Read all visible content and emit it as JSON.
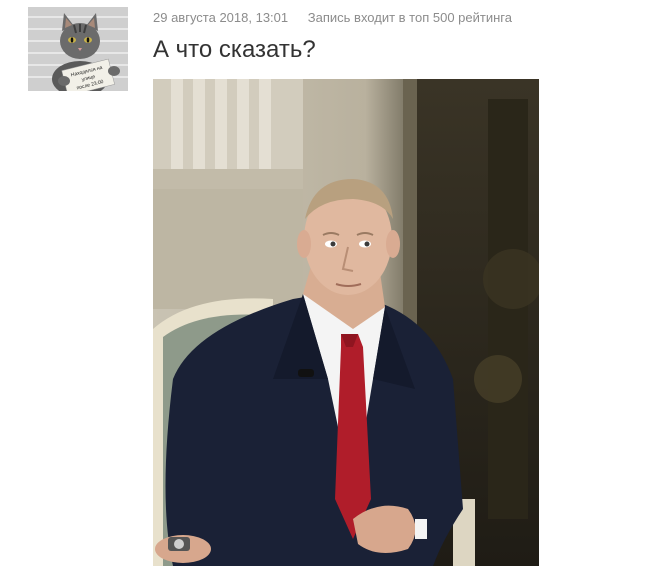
{
  "post": {
    "date": "29 августа 2018, 13:01",
    "rating_note": "Запись входит в топ 500 рейтинга",
    "title": "А что сказать?"
  },
  "avatar": {
    "sign_text": "Находился на улице после 23:00"
  },
  "colors": {
    "meta_text": "#8c8c8c",
    "title_text": "#333333",
    "background": "#ffffff"
  }
}
